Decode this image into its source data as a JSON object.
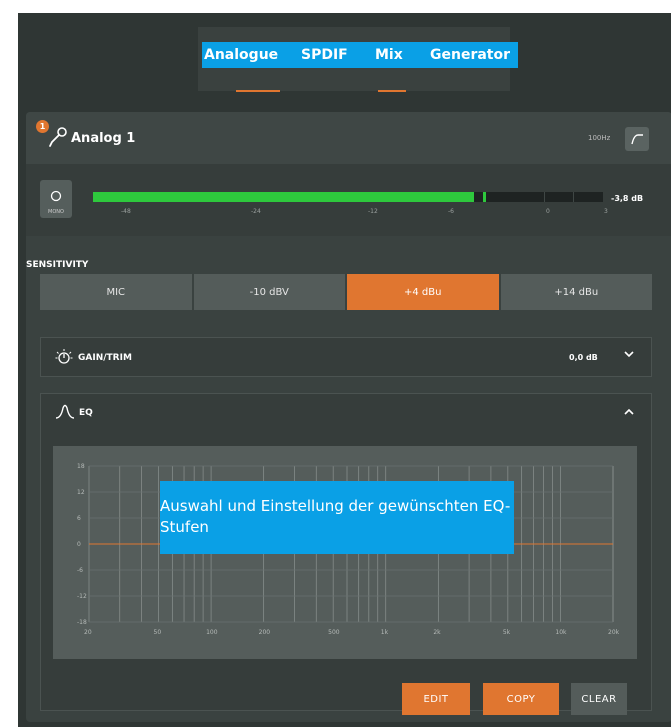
{
  "tabs": [
    {
      "label": "Analogue",
      "active": true
    },
    {
      "label": "SPDIF",
      "active": false
    },
    {
      "label": "Mix",
      "active": true
    },
    {
      "label": "Generator",
      "active": false
    }
  ],
  "channel": {
    "badge": "1",
    "title": "Analog 1",
    "highpass": "100Hz"
  },
  "meter": {
    "mono_label": "MONO",
    "level_fraction": 0.748,
    "peak_fraction": 0.764,
    "scale": [
      "-48",
      "-24",
      "-12",
      "-6",
      "0",
      "3"
    ],
    "readout": "-3,8 dB"
  },
  "sensitivity": {
    "label": "SENSITIVITY",
    "options": [
      "MIC",
      "-10 dBV",
      "+4 dBu",
      "+14 dBu"
    ],
    "selected": "+4 dBu"
  },
  "gain": {
    "label": "GAIN/TRIM",
    "value": "0,0 dB"
  },
  "eq": {
    "label": "EQ",
    "y_ticks": [
      "18",
      "12",
      "6",
      "0",
      "-6",
      "-12",
      "-18"
    ],
    "x_ticks": [
      "20",
      "50",
      "100",
      "200",
      "500",
      "1k",
      "2k",
      "5k",
      "10k",
      "20k"
    ],
    "curve_db": 0
  },
  "annotation": "Auswahl und Einstellung der gewünschten EQ-Stufen",
  "actions": {
    "edit": "EDIT",
    "copy": "COPY",
    "clear": "CLEAR"
  },
  "colors": {
    "accent": "#e07630",
    "meter": "#2ec93d",
    "highlight": "#0aa0e6"
  }
}
